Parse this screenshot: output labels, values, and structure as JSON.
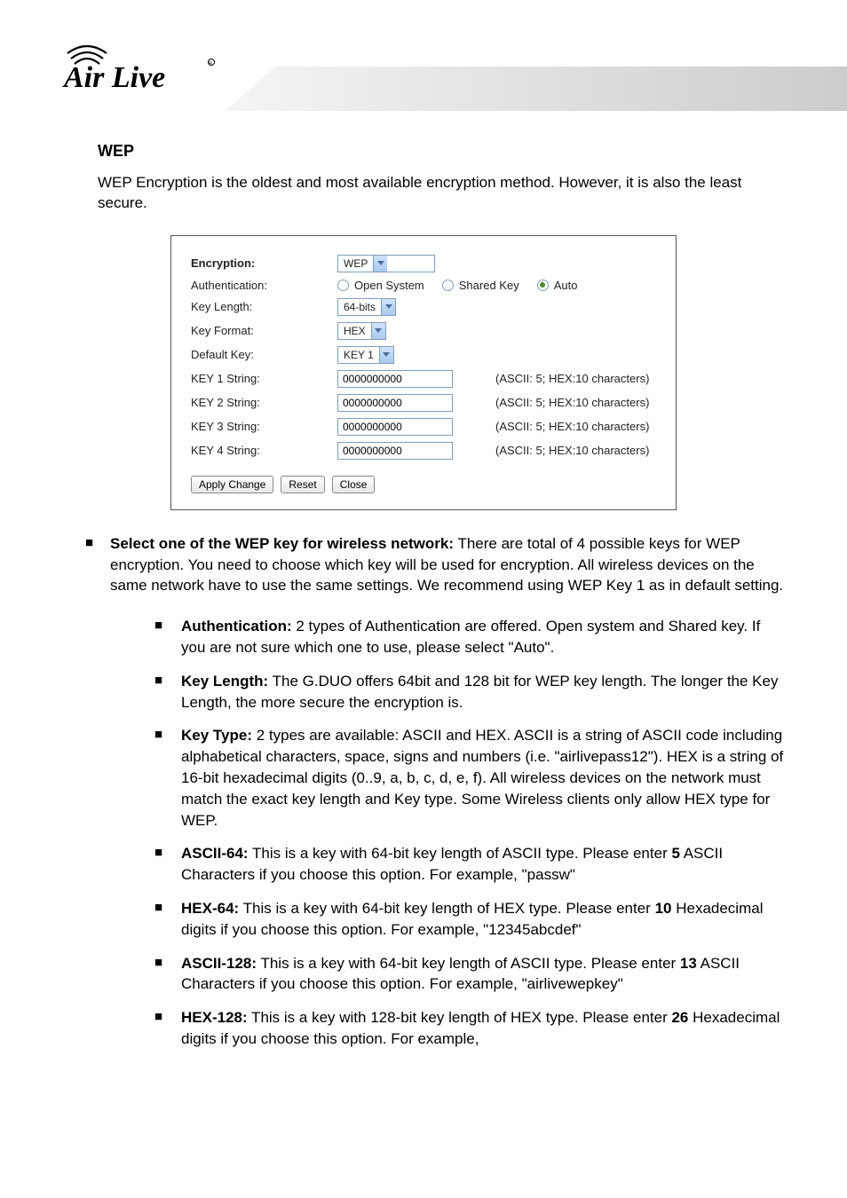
{
  "brand": "Air Live",
  "title": "WEP",
  "intro": "WEP Encryption is the oldest and most available encryption method.   However, it is also the least secure.",
  "form": {
    "encryption_label": "Encryption:",
    "encryption_value": "WEP",
    "auth_label": "Authentication:",
    "auth_opts": {
      "open": "Open System",
      "shared": "Shared Key",
      "auto": "Auto"
    },
    "keylen_label": "Key Length:",
    "keylen_value": "64-bits",
    "keyfmt_label": "Key Format:",
    "keyfmt_value": "HEX",
    "defkey_label": "Default Key:",
    "defkey_value": "KEY 1",
    "keys": [
      {
        "label": "KEY 1 String:",
        "value": "0000000000",
        "hint": "(ASCII: 5; HEX:10 characters)"
      },
      {
        "label": "KEY 2 String:",
        "value": "0000000000",
        "hint": "(ASCII: 5; HEX:10 characters)"
      },
      {
        "label": "KEY 3 String:",
        "value": "0000000000",
        "hint": "(ASCII: 5; HEX:10 characters)"
      },
      {
        "label": "KEY 4 String:",
        "value": "0000000000",
        "hint": "(ASCII: 5; HEX:10 characters)"
      }
    ],
    "apply": "Apply Change",
    "reset": "Reset",
    "close": "Close"
  },
  "bullets": {
    "top": {
      "lead": "Select one of the WEP key for wireless network:",
      "text": "   There are total of 4 possible keys for WEP encryption.   You need to choose which key will be used for encryption.   All wireless devices on the same network have to use the same settings.   We recommend using WEP Key 1 as in default setting."
    },
    "sub": [
      {
        "lead": "Authentication:",
        "text": "   2 types of Authentication are offered.   Open system and Shared key.   If you are not sure which one to use, please select \"Auto\"."
      },
      {
        "lead": "Key Length:",
        "text": "   The G.DUO offers 64bit and 128 bit for WEP key length.   The longer the Key Length, the more secure the encryption is."
      },
      {
        "lead": "Key Type:",
        "text": "   2 types are available: ASCII and HEX.   ASCII is a string of ASCII code including alphabetical characters, space, signs and numbers (i.e. \"airlivepass12\").   HEX is a string of 16-bit hexadecimal digits (0..9, a, b, c, d, e, f).   All wireless devices on the network must match the exact key length and Key type.   Some Wireless clients only allow HEX type for WEP."
      },
      {
        "lead": "ASCII-64:",
        "text_a": " This is a key with 64-bit key length of ASCII type.   Please enter ",
        "bold": "5",
        "text_b": " ASCII Characters if you choose this option. For example, \"passw\""
      },
      {
        "lead": "HEX-64:",
        "text_a": " This is a key with 64-bit key length of HEX type.   Please enter ",
        "bold": "10",
        "text_b": " Hexadecimal digits if you choose this option. For example, \"12345abcdef\""
      },
      {
        "lead": "ASCII-128:",
        "text_a": " This is a key with 64-bit key length of ASCII type.   Please enter ",
        "bold": "13",
        "text_b": " ASCII Characters if you choose this option. For example, \"airlivewepkey\""
      },
      {
        "lead": "HEX-128:",
        "text_a": " This is a key with 128-bit key length of HEX type.   Please enter ",
        "bold": "26",
        "text_b": " Hexadecimal digits if you choose this option. For example,"
      }
    ]
  }
}
